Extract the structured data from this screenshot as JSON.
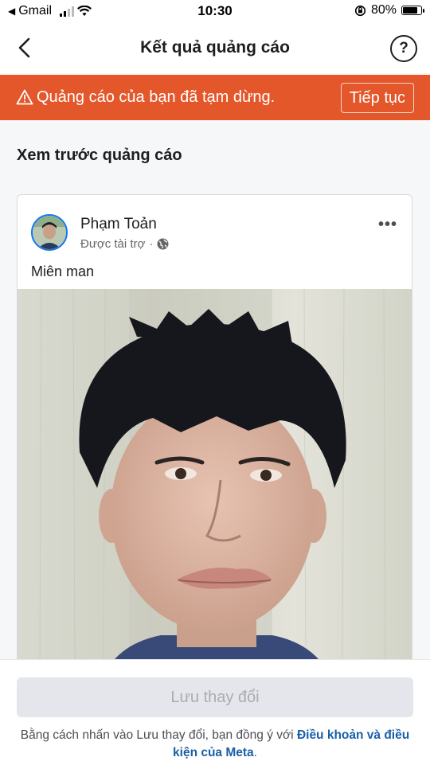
{
  "status_bar": {
    "back_app": "Gmail",
    "time": "10:30",
    "battery": "80%",
    "battery_level": 0.8
  },
  "nav": {
    "title": "Kết quả quảng cáo",
    "help_symbol": "?"
  },
  "alert": {
    "message": "Quảng cáo của bạn đã tạm dừng.",
    "action_label": "Tiếp tục",
    "background_color": "#e4572a"
  },
  "preview": {
    "section_title": "Xem trước quảng cáo",
    "page_name": "Phạm Toản",
    "sponsored_label": "Được tài trợ",
    "separator": "·",
    "more_symbol": "•••",
    "caption": "Miên man"
  },
  "footer": {
    "save_label": "Lưu thay đổi",
    "terms_prefix": "Bằng cách nhấn vào Lưu thay đổi, bạn đồng ý với ",
    "terms_link": "Điều khoản và điều kiện của Meta",
    "terms_suffix": "."
  },
  "colors": {
    "accent": "#1877f2",
    "link": "#1a5fa8",
    "disabled_button": "#e4e6eb"
  }
}
